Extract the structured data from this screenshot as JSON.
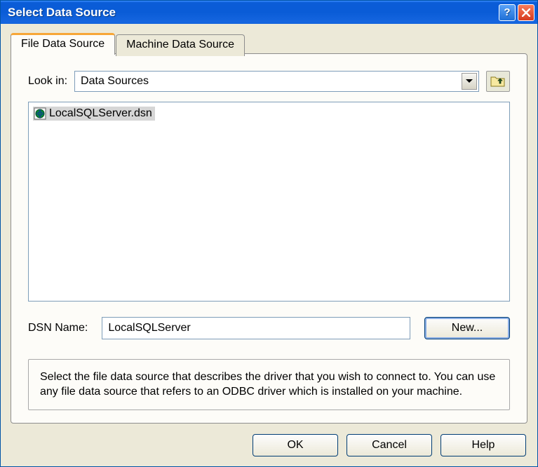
{
  "window": {
    "title": "Select Data Source"
  },
  "tabs": {
    "file": "File Data Source",
    "machine": "Machine Data Source"
  },
  "lookin": {
    "label": "Look in:",
    "value": "Data Sources"
  },
  "filelist": {
    "items": [
      {
        "name": "LocalSQLServer.dsn",
        "selected": true
      }
    ]
  },
  "dsn": {
    "label": "DSN Name:",
    "value": "LocalSQLServer"
  },
  "buttons": {
    "new": "New...",
    "ok": "OK",
    "cancel": "Cancel",
    "help": "Help"
  },
  "info": "Select the file data source that describes the driver that you wish to connect to. You can use any file data source that refers to an ODBC driver which is installed on your machine."
}
